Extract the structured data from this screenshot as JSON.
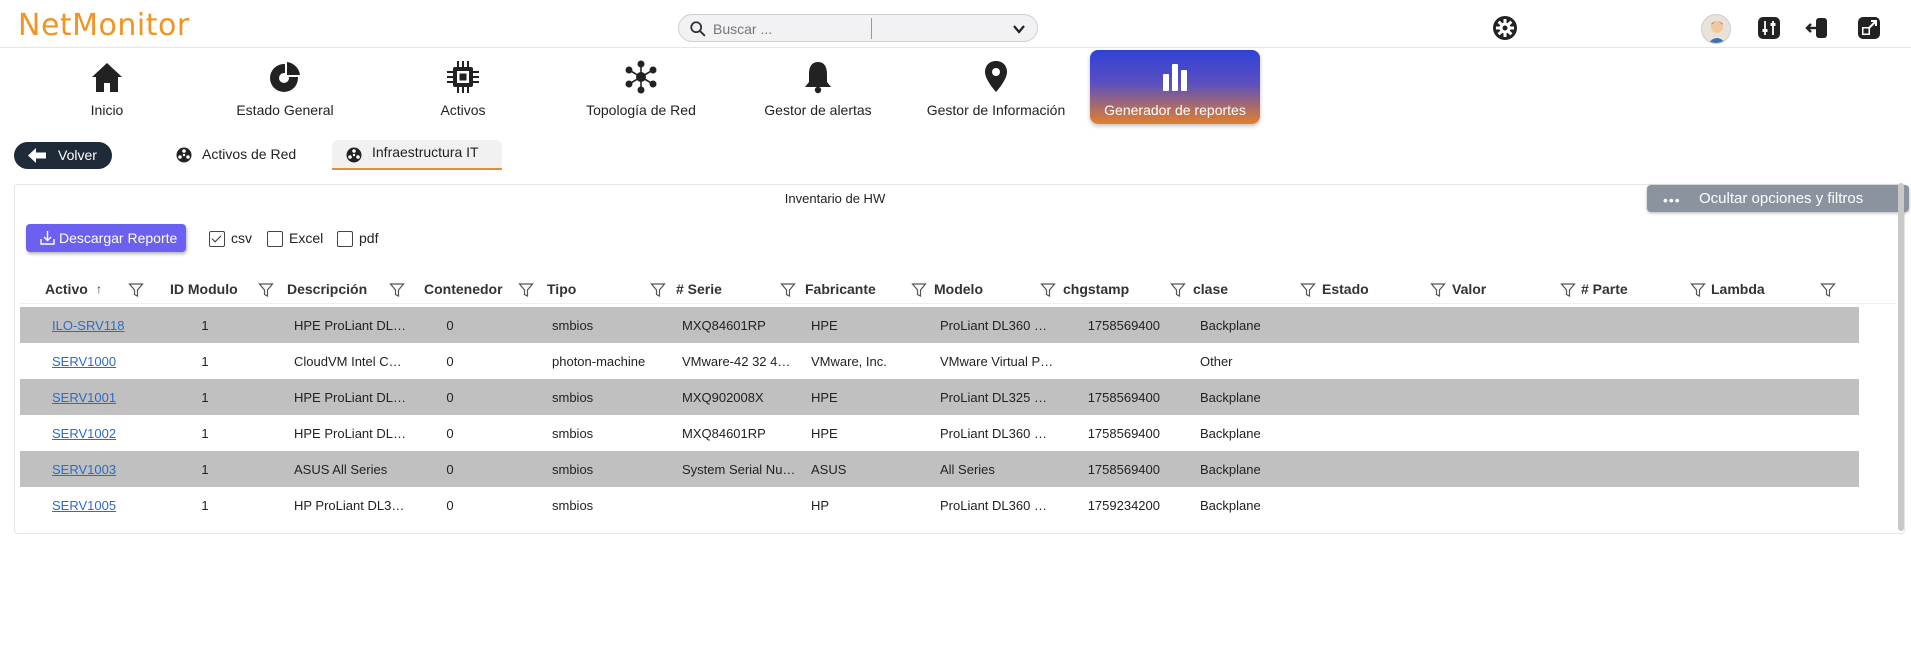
{
  "app": {
    "logo": "NetMonitor",
    "search_placeholder": "Buscar ...",
    "search_filter_value": ""
  },
  "header_icons": [
    "gear-icon",
    "avatar",
    "equalizer-icon",
    "logout-icon",
    "external-link-icon"
  ],
  "nav": [
    {
      "label": "Inicio",
      "icon": "home-icon"
    },
    {
      "label": "Estado General",
      "icon": "pie-chart-icon"
    },
    {
      "label": "Activos",
      "icon": "chip-icon"
    },
    {
      "label": "Topología de Red",
      "icon": "network-icon"
    },
    {
      "label": "Gestor de alertas",
      "icon": "bell-icon"
    },
    {
      "label": "Gestor de Información",
      "icon": "location-pin-icon"
    },
    {
      "label": "Generador de reportes",
      "icon": "bar-chart-icon",
      "active": true
    }
  ],
  "subnav": {
    "back_label": "Volver",
    "tabs": [
      {
        "label": "Activos de Red",
        "active": false
      },
      {
        "label": "Infraestructura IT",
        "active": true
      }
    ]
  },
  "panel": {
    "title": "Inventario de HW",
    "hide_label": "Ocultar opciones y filtros",
    "download_label": "Descargar Reporte",
    "formats": [
      {
        "label": "csv",
        "checked": true
      },
      {
        "label": "Excel",
        "checked": false
      },
      {
        "label": "pdf",
        "checked": false
      }
    ]
  },
  "table": {
    "columns": [
      "Activo",
      "ID Modulo",
      "Descripción",
      "Contenedor",
      "Tipo",
      "# Serie",
      "Fabricante",
      "Modelo",
      "chgstamp",
      "clase",
      "Estado",
      "Valor",
      "# Parte",
      "Lambda"
    ],
    "sort_indicator": "↑",
    "rows": [
      [
        "ILO-SRV118",
        "1",
        "HPE ProLiant DL…",
        "0",
        "smbios",
        "MXQ84601RP",
        "HPE",
        "ProLiant DL360 …",
        "1758569400",
        "Backplane",
        "",
        "",
        "",
        ""
      ],
      [
        "SERV1000",
        "1",
        "CloudVM Intel C…",
        "0",
        "photon-machine",
        "VMware-42 32 4…",
        "VMware, Inc.",
        "VMware Virtual P…",
        "",
        "Other",
        "",
        "",
        "",
        ""
      ],
      [
        "SERV1001",
        "1",
        "HPE ProLiant DL…",
        "0",
        "smbios",
        "MXQ902008X",
        "HPE",
        "ProLiant DL325 …",
        "1758569400",
        "Backplane",
        "",
        "",
        "",
        ""
      ],
      [
        "SERV1002",
        "1",
        "HPE ProLiant DL…",
        "0",
        "smbios",
        "MXQ84601RP",
        "HPE",
        "ProLiant DL360 …",
        "1758569400",
        "Backplane",
        "",
        "",
        "",
        ""
      ],
      [
        "SERV1003",
        "1",
        "ASUS All Series",
        "0",
        "smbios",
        "System Serial Nu…",
        "ASUS",
        "All Series",
        "1758569400",
        "Backplane",
        "",
        "",
        "",
        ""
      ],
      [
        "SERV1005",
        "1",
        "HP ProLiant DL3…",
        "0",
        "smbios",
        "",
        "HP",
        "ProLiant DL360 …",
        "1759234200",
        "Backplane",
        "",
        "",
        "",
        ""
      ]
    ]
  },
  "colors": {
    "brand": "#f39322",
    "link": "#2d6cc2",
    "row_shade": "#c0c0c0",
    "download_button": "#6b60f0",
    "back_button": "#1e2a38"
  }
}
